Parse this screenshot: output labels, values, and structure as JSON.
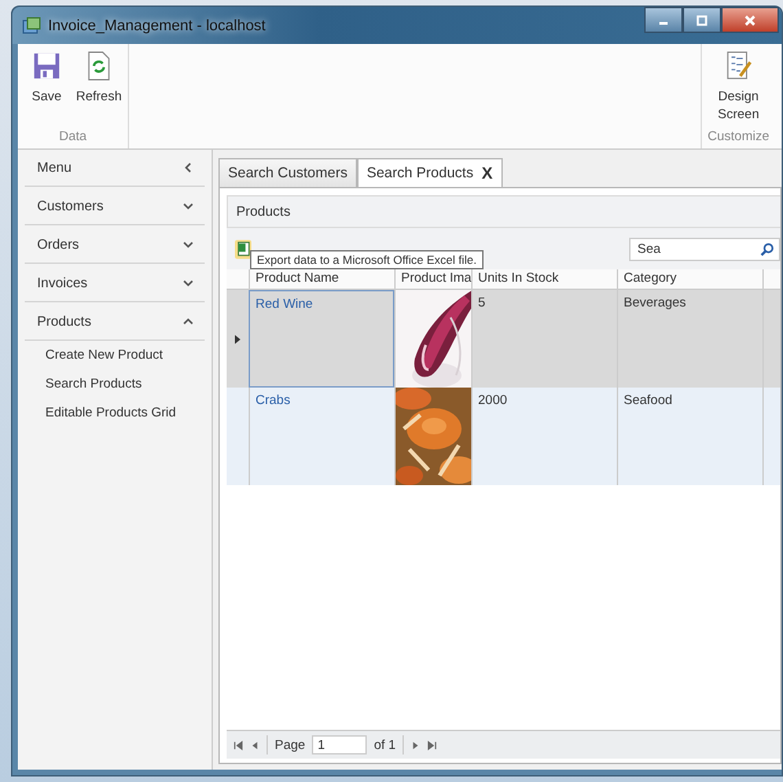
{
  "window": {
    "title": "Invoice_Management - localhost"
  },
  "ribbon": {
    "groups": [
      {
        "label": "Data",
        "buttons": [
          {
            "label": "Save",
            "kind": "save"
          },
          {
            "label": "Refresh",
            "kind": "refresh"
          }
        ]
      },
      {
        "label": "Customize",
        "buttons": [
          {
            "label": "Design Screen",
            "kind": "design"
          }
        ]
      }
    ]
  },
  "sidebar": {
    "title": "Menu",
    "items": [
      {
        "label": "Customers",
        "expanded": false
      },
      {
        "label": "Orders",
        "expanded": false
      },
      {
        "label": "Invoices",
        "expanded": false
      },
      {
        "label": "Products",
        "expanded": true,
        "children": [
          {
            "label": "Create New Product"
          },
          {
            "label": "Search Products"
          },
          {
            "label": "Editable Products Grid"
          }
        ]
      }
    ]
  },
  "tabs": [
    {
      "label": "Search Customers",
      "selected": false
    },
    {
      "label": "Search Products",
      "selected": true,
      "close": "X"
    }
  ],
  "panel": {
    "title": "Products",
    "search": {
      "value": "Sea"
    },
    "tooltip": "Export data to a Microsoft Office Excel file.",
    "columns": [
      "Product Name",
      "Product Ima",
      "Units In Stock",
      "Category"
    ],
    "rows": [
      {
        "selected": true,
        "name": "Red Wine",
        "units": "5",
        "category": "Beverages"
      },
      {
        "selected": false,
        "name": "Crabs",
        "units": "2000",
        "category": "Seafood"
      }
    ],
    "pager": {
      "label": "Page",
      "page": "1",
      "total": "of 1"
    }
  }
}
